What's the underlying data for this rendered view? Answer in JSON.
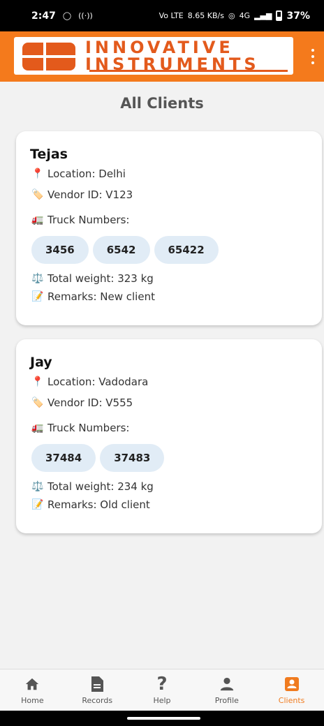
{
  "status_bar": {
    "time": "2:47",
    "left_icons": [
      "whatsapp-icon",
      "hotspot-icon"
    ],
    "net_type": "Vo LTE",
    "speed": "8.65 KB/s",
    "network": "4G",
    "battery": "37%"
  },
  "app_bar": {
    "logo_line1": "INNOVATIVE",
    "logo_line2": "INSTRUMENTS",
    "brand_color": "#f47a1c",
    "logo_color": "#e35a1c"
  },
  "page": {
    "title": "All Clients"
  },
  "clients": [
    {
      "name": "Tejas",
      "location": "Location: Delhi",
      "vendor": "Vendor ID: V123",
      "truck_label": "Truck Numbers:",
      "trucks": [
        "3456",
        "6542",
        "65422"
      ],
      "weight": "Total weight: 323 kg",
      "remarks": "Remarks: New client"
    },
    {
      "name": "Jay",
      "location": "Location: Vadodara",
      "vendor": "Vendor ID: V555",
      "truck_label": "Truck Numbers:",
      "trucks": [
        "37484",
        "37483"
      ],
      "weight": "Total weight: 234 kg",
      "remarks": "Remarks: Old client"
    }
  ],
  "icons": {
    "location": "📍",
    "vendor": "🏷️",
    "truck": "🚛",
    "weight": "⚖️",
    "remarks": "📝"
  },
  "bottom_nav": [
    {
      "label": "Home",
      "icon": "home-icon",
      "glyph": "🏠"
    },
    {
      "label": "Records",
      "icon": "document-icon",
      "glyph": "📄"
    },
    {
      "label": "Help",
      "icon": "help-icon",
      "glyph": "?"
    },
    {
      "label": "Profile",
      "icon": "profile-icon",
      "glyph": "👤"
    },
    {
      "label": "Clients",
      "icon": "clients-icon",
      "glyph": "🪪",
      "active": true
    }
  ],
  "accent_active": "#f07b1f"
}
